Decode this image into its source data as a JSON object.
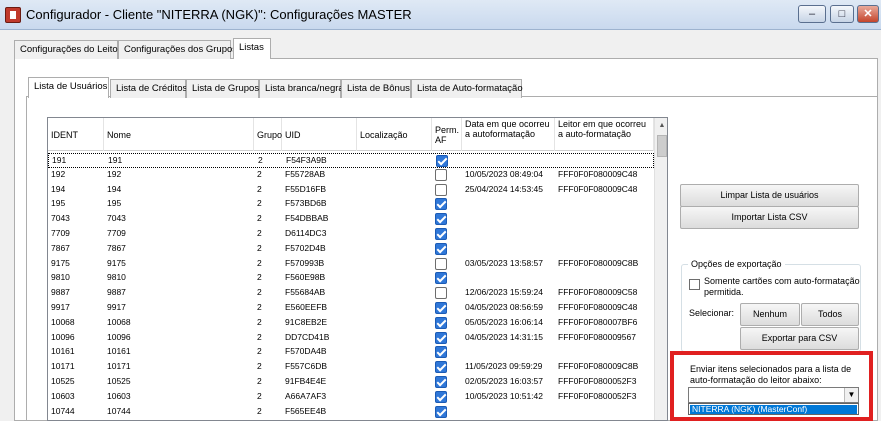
{
  "window": {
    "title": "Configurador - Cliente \"NITERRA (NGK)\": Configurações MASTER",
    "minimize_icon": "minimize-icon",
    "maximize_icon": "maximize-icon",
    "close_icon": "close-icon",
    "minimize_glyph": "–",
    "maximize_glyph": "□",
    "close_glyph": "✕"
  },
  "main_tabs": [
    {
      "label": "Configurações do Leitor"
    },
    {
      "label": "Configurações dos Grupos"
    },
    {
      "label": "Listas"
    }
  ],
  "sub_tabs": [
    {
      "label": "Lista de Usuários"
    },
    {
      "label": "Lista de Créditos"
    },
    {
      "label": "Lista de Grupos"
    },
    {
      "label": "Lista branca/negra"
    },
    {
      "label": "Lista de Bônus"
    },
    {
      "label": "Lista de Auto-formatação"
    }
  ],
  "table": {
    "columns": [
      "IDENT",
      "Nome",
      "Grupo",
      "UID",
      "Localização",
      "Perm. AF",
      "Data em que ocorreu a autoformatação",
      "Leitor em que ocorreu a auto-formatação"
    ],
    "rows": [
      {
        "ident": "191",
        "nome": "191",
        "grupo": "2",
        "uid": "F54F3A9B",
        "loc": "",
        "af": true,
        "data": "",
        "leitor": ""
      },
      {
        "ident": "192",
        "nome": "192",
        "grupo": "2",
        "uid": "F55728AB",
        "loc": "",
        "af": false,
        "data": "10/05/2023 08:49:04",
        "leitor": "FFF0F0F080009C48"
      },
      {
        "ident": "194",
        "nome": "194",
        "grupo": "2",
        "uid": "F55D16FB",
        "loc": "",
        "af": false,
        "data": "25/04/2024 14:53:45",
        "leitor": "FFF0F0F080009C48"
      },
      {
        "ident": "195",
        "nome": "195",
        "grupo": "2",
        "uid": "F573BD6B",
        "loc": "",
        "af": true,
        "data": "",
        "leitor": ""
      },
      {
        "ident": "7043",
        "nome": "7043",
        "grupo": "2",
        "uid": "F54DBBAB",
        "loc": "",
        "af": true,
        "data": "",
        "leitor": ""
      },
      {
        "ident": "7709",
        "nome": "7709",
        "grupo": "2",
        "uid": "D6114DC3",
        "loc": "",
        "af": true,
        "data": "",
        "leitor": ""
      },
      {
        "ident": "7867",
        "nome": "7867",
        "grupo": "2",
        "uid": "F5702D4B",
        "loc": "",
        "af": true,
        "data": "",
        "leitor": ""
      },
      {
        "ident": "9175",
        "nome": "9175",
        "grupo": "2",
        "uid": "F570993B",
        "loc": "",
        "af": false,
        "data": "03/05/2023 13:58:57",
        "leitor": "FFF0F0F080009C8B"
      },
      {
        "ident": "9810",
        "nome": "9810",
        "grupo": "2",
        "uid": "F560E98B",
        "loc": "",
        "af": true,
        "data": "",
        "leitor": ""
      },
      {
        "ident": "9887",
        "nome": "9887",
        "grupo": "2",
        "uid": "F55684AB",
        "loc": "",
        "af": false,
        "data": "12/06/2023 15:59:24",
        "leitor": "FFF0F0F080009C58"
      },
      {
        "ident": "9917",
        "nome": "9917",
        "grupo": "2",
        "uid": "E560EEFB",
        "loc": "",
        "af": true,
        "data": "04/05/2023 08:56:59",
        "leitor": "FFF0F0F080009C48"
      },
      {
        "ident": "10068",
        "nome": "10068",
        "grupo": "2",
        "uid": "91C8EB2E",
        "loc": "",
        "af": true,
        "data": "05/05/2023 16:06:14",
        "leitor": "FFF0F0F080007BF6"
      },
      {
        "ident": "10096",
        "nome": "10096",
        "grupo": "2",
        "uid": "DD7CD41B",
        "loc": "",
        "af": true,
        "data": "04/05/2023 14:31:15",
        "leitor": "FFF0F0F080009567"
      },
      {
        "ident": "10161",
        "nome": "10161",
        "grupo": "2",
        "uid": "F570DA4B",
        "loc": "",
        "af": true,
        "data": "",
        "leitor": ""
      },
      {
        "ident": "10171",
        "nome": "10171",
        "grupo": "2",
        "uid": "F557C6DB",
        "loc": "",
        "af": true,
        "data": "11/05/2023 09:59:29",
        "leitor": "FFF0F0F080009C8B"
      },
      {
        "ident": "10525",
        "nome": "10525",
        "grupo": "2",
        "uid": "91FB4E4E",
        "loc": "",
        "af": true,
        "data": "02/05/2023 16:03:57",
        "leitor": "FFF0F0F0800052F3"
      },
      {
        "ident": "10603",
        "nome": "10603",
        "grupo": "2",
        "uid": "A66A7AF3",
        "loc": "",
        "af": true,
        "data": "10/05/2023 10:51:42",
        "leitor": "FFF0F0F0800052F3"
      },
      {
        "ident": "10744",
        "nome": "10744",
        "grupo": "2",
        "uid": "F565EE4B",
        "loc": "",
        "af": true,
        "data": "",
        "leitor": ""
      }
    ],
    "scroll_up_glyph": "▲"
  },
  "actions": {
    "clear_label": "Limpar Lista de usuários",
    "import_label": "Importar Lista CSV"
  },
  "export": {
    "group_title": "Opções de exportação",
    "only_af_label": "Somente cartões com auto-formatação permitida.",
    "select_label": "Selecionar:",
    "none_label": "Nenhum",
    "all_label": "Todos",
    "export_label": "Exportar para CSV"
  },
  "send": {
    "label": "Enviar itens selecionados para a lista de auto-formatação do leitor abaixo:",
    "combo_value": "",
    "dropdown_arrow": "▼",
    "option": "NITERRA (NGK) (MasterConf)"
  },
  "colors": {
    "highlight_border": "#e02020",
    "selection_blue": "#0078d7",
    "checkbox_blue": "#2f77d8"
  }
}
